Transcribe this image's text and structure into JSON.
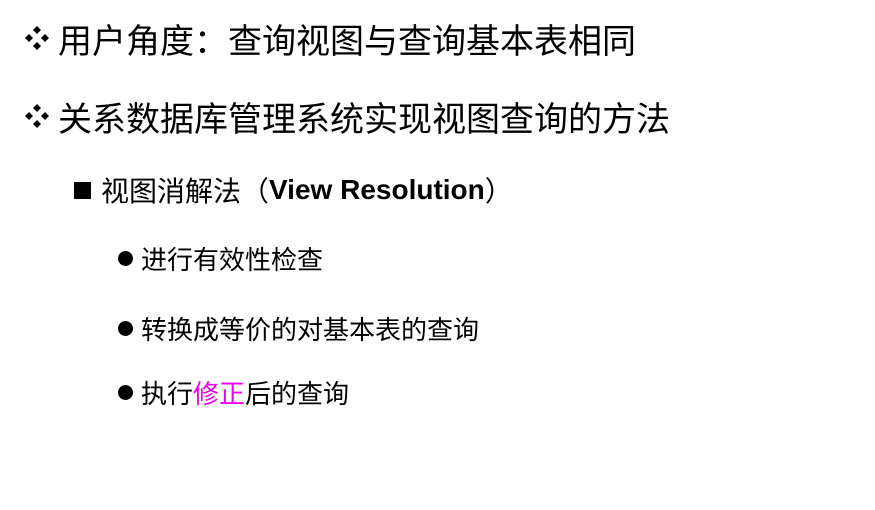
{
  "lines": [
    {
      "text": "用户角度：查询视图与查询基本表相同",
      "bullet": "diamond-icon"
    },
    {
      "text": "关系数据库管理系统实现视图查询的方法",
      "bullet": "diamond-icon"
    },
    {
      "text_prefix": "视图消解法（",
      "text_latin": "View Resolution",
      "text_suffix": "）",
      "bullet": "square-icon"
    },
    {
      "text": "进行有效性检查",
      "bullet": "dot-icon"
    },
    {
      "text": "转换成等价的对基本表的查询",
      "bullet": "dot-icon"
    },
    {
      "text_prefix": "执行",
      "text_highlight": "修正",
      "text_suffix": "后的查询",
      "bullet": "dot-icon"
    }
  ],
  "colors": {
    "text": "#000000",
    "highlight": "#ee00ee",
    "background": "#ffffff"
  }
}
